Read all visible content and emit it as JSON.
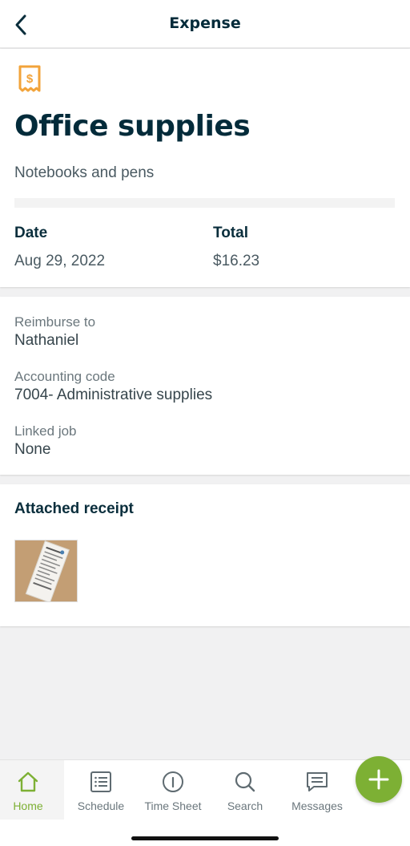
{
  "header": {
    "title": "Expense"
  },
  "expense": {
    "title": "Office supplies",
    "description": "Notebooks and pens",
    "date_label": "Date",
    "date_value": "Aug 29, 2022",
    "total_label": "Total",
    "total_value": "$16.23"
  },
  "details": {
    "reimburse_label": "Reimburse to",
    "reimburse_value": "Nathaniel",
    "accounting_label": "Accounting code",
    "accounting_value": "7004- Administrative supplies",
    "job_label": "Linked job",
    "job_value": "None"
  },
  "receipt": {
    "section_title": "Attached receipt"
  },
  "tabs": [
    {
      "label": "Home",
      "icon": "home-icon",
      "active": true
    },
    {
      "label": "Schedule",
      "icon": "list-icon",
      "active": false
    },
    {
      "label": "Time Sheet",
      "icon": "clock-icon",
      "active": false
    },
    {
      "label": "Search",
      "icon": "search-icon",
      "active": false
    },
    {
      "label": "Messages",
      "icon": "message-icon",
      "active": false
    }
  ],
  "colors": {
    "accent": "#7db034",
    "receipt_icon": "#f2a33a",
    "title": "#032b3a"
  }
}
